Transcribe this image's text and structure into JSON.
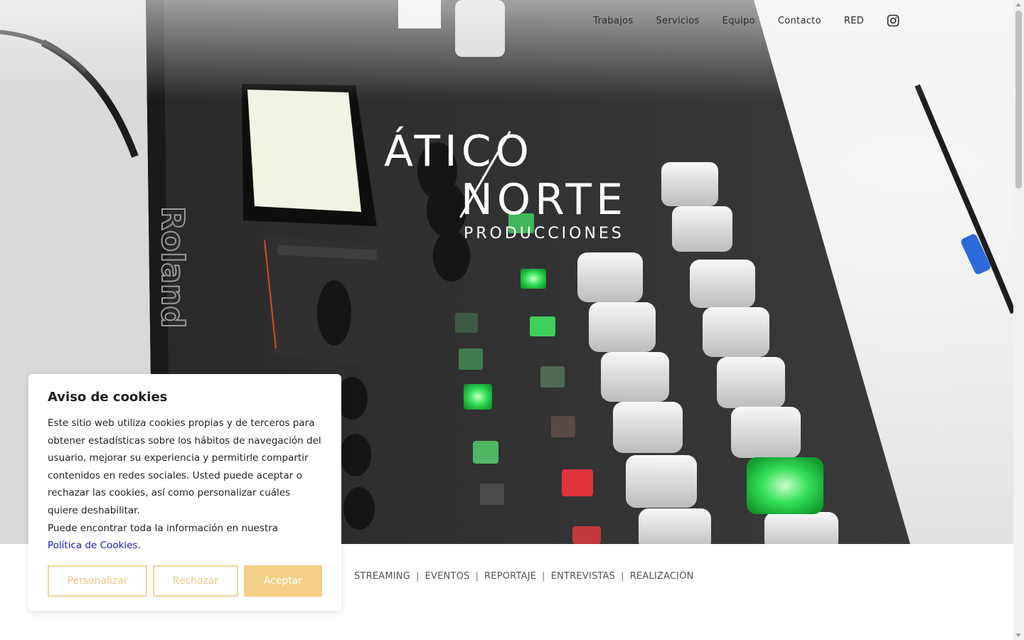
{
  "nav": {
    "items": [
      "Trabajos",
      "Servicios",
      "Equipo",
      "Contacto",
      "RED"
    ],
    "instagram_icon": "instagram-icon"
  },
  "logo": {
    "line1": "ÁTICO",
    "line2": "NORTE",
    "line3": "PRODUCCIONES"
  },
  "categories": [
    "STREAMING",
    "EVENTOS",
    "REPORTAJE",
    "ENTREVISTAS",
    "REALIZACIÓN"
  ],
  "cookie": {
    "title": "Aviso de cookies",
    "body": "Este sitio web utiliza cookies propias y de terceros para obtener estadísticas sobre los hábitos de navegación del usuario, mejorar su experiencia y permitirle compartir contenidos en redes sociales. Usted puede aceptar o rechazar las cookies, así como personalizar cuáles quiere deshabilitar.",
    "info_text": "Puede encontrar toda la información en nuestra",
    "policy_link": "Política de Cookies",
    "buttons": {
      "customize": "Personalizar",
      "reject": "Rechazar",
      "accept": "Aceptar"
    }
  },
  "colors": {
    "accent": "#f5cf87",
    "link": "#1a1ab8"
  }
}
